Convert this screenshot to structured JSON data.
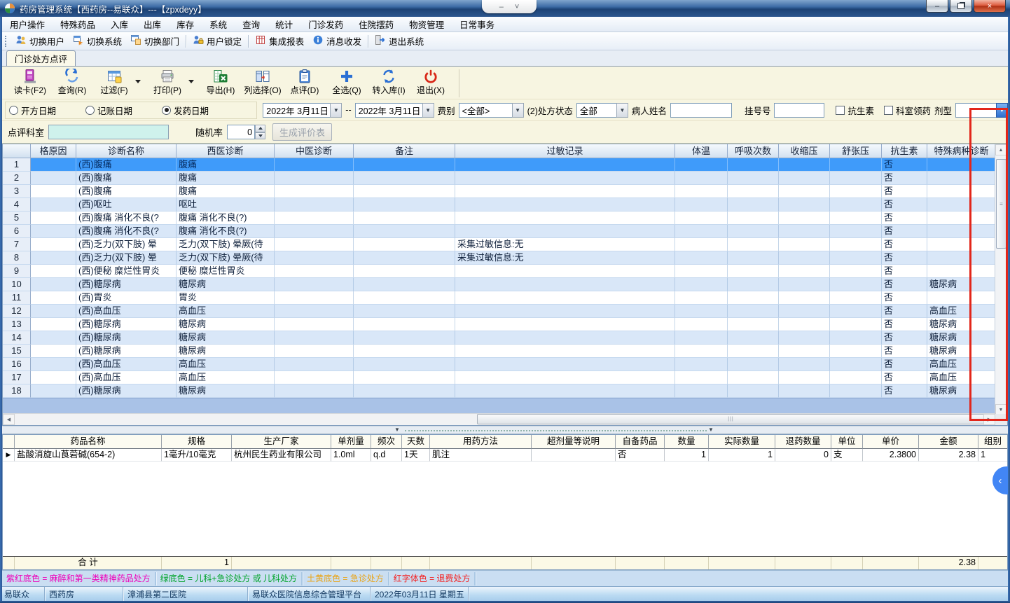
{
  "window": {
    "title": "药房管理系统【西药房--易联众】---【zpxdeyy】"
  },
  "icons": {
    "minimize": "–",
    "close": "×",
    "dropdown": "▼",
    "scroll_up": "▲",
    "scroll_down": "▼",
    "scroll_left": "◀",
    "scroll_right": "▶",
    "grip": "|||",
    "grip_v": "≡",
    "row_marker": "▶",
    "collapse_left": "‹",
    "pill_minimize": "–",
    "pill_chevron": "˅",
    "splitter_arrow": "▼"
  },
  "menu": {
    "items": [
      "用户操作",
      "特殊药品",
      "入库",
      "出库",
      "库存",
      "系统",
      "查询",
      "统计",
      "门诊发药",
      "住院摆药",
      "物资管理",
      "日常事务"
    ]
  },
  "toolbar": {
    "items": [
      {
        "label": "切换用户",
        "icon": "switch-user-icon",
        "sep_after": false
      },
      {
        "label": "切换系统",
        "icon": "switch-system-icon",
        "sep_after": false
      },
      {
        "label": "切换部门",
        "icon": "switch-dept-icon",
        "sep_after": true
      },
      {
        "label": "用户锁定",
        "icon": "user-lock-icon",
        "sep_after": true
      },
      {
        "label": "集成报表",
        "icon": "report-grid-icon",
        "sep_after": false
      },
      {
        "label": "消息收发",
        "icon": "message-info-icon",
        "sep_after": true
      },
      {
        "label": "退出系统",
        "icon": "exit-system-icon",
        "sep_after": false
      }
    ]
  },
  "tab": {
    "label": "门诊处方点评"
  },
  "actions": {
    "buttons": [
      {
        "label": "读卡(F2)",
        "icon": "card-reader-icon",
        "dropdown": false
      },
      {
        "label": "查询(R)",
        "icon": "query-icon",
        "dropdown": false
      },
      {
        "label": "过滤(F)",
        "icon": "filter-grid-icon",
        "dropdown": true
      },
      {
        "label": "打印(P)",
        "icon": "printer-icon",
        "dropdown": true
      },
      {
        "label": "导出(H)",
        "icon": "excel-export-icon",
        "dropdown": false
      },
      {
        "label": "列选择(O)",
        "icon": "column-select-icon",
        "dropdown": false
      },
      {
        "label": "点评(D)",
        "icon": "review-clipboard-icon",
        "dropdown": false
      },
      {
        "label": "全选(Q)",
        "icon": "select-all-plus-icon",
        "dropdown": false
      },
      {
        "label": "转入库(I)",
        "icon": "transfer-sync-icon",
        "dropdown": false
      },
      {
        "label": "退出(X)",
        "icon": "power-exit-icon",
        "dropdown": false
      }
    ]
  },
  "filters": {
    "radios": [
      {
        "label": "开方日期",
        "checked": false
      },
      {
        "label": "记账日期",
        "checked": false
      },
      {
        "label": "发药日期",
        "checked": true
      }
    ],
    "date_from": "2022年 3月11日",
    "range_sep": "--",
    "date_to": "2022年 3月11日",
    "fee_label": "费别",
    "fee_value": "<全部>",
    "status_label": "(2)处方状态",
    "status_value": "全部",
    "patient_label": "病人姓名",
    "patient_value": "",
    "regno_label": "挂号号",
    "regno_value": "",
    "antibiotic_label": "抗生素",
    "antibiotic_checked": false,
    "dept_drug_label": "科室领药",
    "dept_drug_checked": false,
    "dosage_label": "剂型",
    "dosage_value": ""
  },
  "review": {
    "dept_label": "点评科室",
    "dept_value": "",
    "random_label": "随机率",
    "random_value": "0",
    "generate_label": "生成评价表"
  },
  "main_grid": {
    "headers": [
      "",
      "格原因",
      "诊断名称",
      "西医诊断",
      "中医诊断",
      "备注",
      "过敏记录",
      "体温",
      "呼吸次数",
      "收缩压",
      "舒张压",
      "抗生素",
      "特殊病种诊断"
    ],
    "rows": [
      [
        "1",
        "",
        "(西)腹痛",
        "腹痛",
        "",
        "",
        "",
        "",
        "",
        "",
        "",
        "否",
        ""
      ],
      [
        "2",
        "",
        "(西)腹痛",
        "腹痛",
        "",
        "",
        "",
        "",
        "",
        "",
        "",
        "否",
        ""
      ],
      [
        "3",
        "",
        "(西)腹痛",
        "腹痛",
        "",
        "",
        "",
        "",
        "",
        "",
        "",
        "否",
        ""
      ],
      [
        "4",
        "",
        "(西)呕吐",
        "呕吐",
        "",
        "",
        "",
        "",
        "",
        "",
        "",
        "否",
        ""
      ],
      [
        "5",
        "",
        "(西)腹痛 消化不良(?",
        "腹痛 消化不良(?)",
        "",
        "",
        "",
        "",
        "",
        "",
        "",
        "否",
        ""
      ],
      [
        "6",
        "",
        "(西)腹痛 消化不良(?",
        "腹痛 消化不良(?)",
        "",
        "",
        "",
        "",
        "",
        "",
        "",
        "否",
        ""
      ],
      [
        "7",
        "",
        "(西)乏力(双下肢) 晕",
        "乏力(双下肢) 晕厥(待",
        "",
        "",
        "采集过敏信息:无",
        "",
        "",
        "",
        "",
        "否",
        ""
      ],
      [
        "8",
        "",
        "(西)乏力(双下肢) 晕",
        "乏力(双下肢) 晕厥(待",
        "",
        "",
        "采集过敏信息:无",
        "",
        "",
        "",
        "",
        "否",
        ""
      ],
      [
        "9",
        "",
        "(西)便秘 糜烂性胃炎",
        "便秘 糜烂性胃炎",
        "",
        "",
        "",
        "",
        "",
        "",
        "",
        "否",
        ""
      ],
      [
        "10",
        "",
        "(西)糖尿病",
        "糖尿病",
        "",
        "",
        "",
        "",
        "",
        "",
        "",
        "否",
        "糖尿病"
      ],
      [
        "11",
        "",
        "(西)胃炎",
        "胃炎",
        "",
        "",
        "",
        "",
        "",
        "",
        "",
        "否",
        ""
      ],
      [
        "12",
        "",
        "(西)高血压",
        "高血压",
        "",
        "",
        "",
        "",
        "",
        "",
        "",
        "否",
        "高血压"
      ],
      [
        "13",
        "",
        "(西)糖尿病",
        "糖尿病",
        "",
        "",
        "",
        "",
        "",
        "",
        "",
        "否",
        "糖尿病"
      ],
      [
        "14",
        "",
        "(西)糖尿病",
        "糖尿病",
        "",
        "",
        "",
        "",
        "",
        "",
        "",
        "否",
        "糖尿病"
      ],
      [
        "15",
        "",
        "(西)糖尿病",
        "糖尿病",
        "",
        "",
        "",
        "",
        "",
        "",
        "",
        "否",
        "糖尿病"
      ],
      [
        "16",
        "",
        "(西)高血压",
        "高血压",
        "",
        "",
        "",
        "",
        "",
        "",
        "",
        "否",
        "高血压"
      ],
      [
        "17",
        "",
        "(西)高血压",
        "高血压",
        "",
        "",
        "",
        "",
        "",
        "",
        "",
        "否",
        "高血压"
      ],
      [
        "18",
        "",
        "(西)糖尿病",
        "糖尿病",
        "",
        "",
        "",
        "",
        "",
        "",
        "",
        "否",
        "糖尿病"
      ]
    ],
    "selected_row_index": 0
  },
  "drug_grid": {
    "headers": [
      "",
      "药品名称",
      "规格",
      "生产厂家",
      "单剂量",
      "频次",
      "天数",
      "用药方法",
      "超剂量等说明",
      "自备药品",
      "数量",
      "实际数量",
      "退药数量",
      "单位",
      "单价",
      "金额",
      "组别"
    ],
    "rows": [
      [
        "▶",
        "盐酸消旋山莨菪碱(654-2)",
        "1毫升/10毫克",
        "杭州民生药业有限公司",
        "1.0ml",
        "q.d",
        "1天",
        "肌注",
        "",
        "否",
        "1",
        "1",
        "0",
        "支",
        "2.3800",
        "2.38",
        "1"
      ]
    ],
    "totals": {
      "label": "合  计",
      "qty": "1",
      "amount": "2.38"
    }
  },
  "legend": {
    "items": [
      {
        "text": "紫红底色 = 麻醉和第一类精神药品处方",
        "color": "#ee00bb"
      },
      {
        "text": "绿底色 = 儿科+急诊处方 或 儿科处方",
        "color": "#00a42a"
      },
      {
        "text": "土黄底色 = 急诊处方",
        "color": "#e9a416"
      },
      {
        "text": "红字体色 = 退费处方",
        "color": "#f42020"
      }
    ]
  },
  "statusbar": {
    "items": [
      "易联众",
      "西药房",
      "漳浦县第二医院",
      "易联众医院信息综合管理平台",
      "2022年03月11日 星期五"
    ]
  }
}
